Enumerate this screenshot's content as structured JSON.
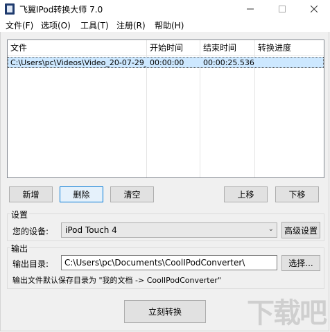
{
  "window": {
    "title": "飞翼IPod转换大师 7.0"
  },
  "menu": [
    "文件(F)",
    "选项(O)",
    "工具(T)",
    "注册(R)",
    "帮助(H)"
  ],
  "table": {
    "headers": [
      "文件",
      "开始时间",
      "结束时间",
      "转换进度"
    ],
    "rows": [
      {
        "file": "C:\\Users\\pc\\Videos\\Video_20-07-29_...",
        "start": "00:00:00",
        "end": "00:00:25.536",
        "progress": ""
      }
    ]
  },
  "buttons": {
    "add": "新增",
    "delete": "删除",
    "clear": "清空",
    "up": "上移",
    "down": "下移"
  },
  "settings": {
    "group_title": "设置",
    "device_label": "您的设备:",
    "device_value": "iPod Touch 4",
    "advanced_button": "高级设置"
  },
  "output": {
    "group_title": "输出",
    "dir_label": "输出目录:",
    "dir_value": "C:\\Users\\pc\\Documents\\CoolIPodConverter\\",
    "browse_button": "选择...",
    "note": "输出文件默认保存目录为 \"我的文档 -> CoolIPodConverter\""
  },
  "convert_button": "立刻转换",
  "watermark": "下载吧"
}
